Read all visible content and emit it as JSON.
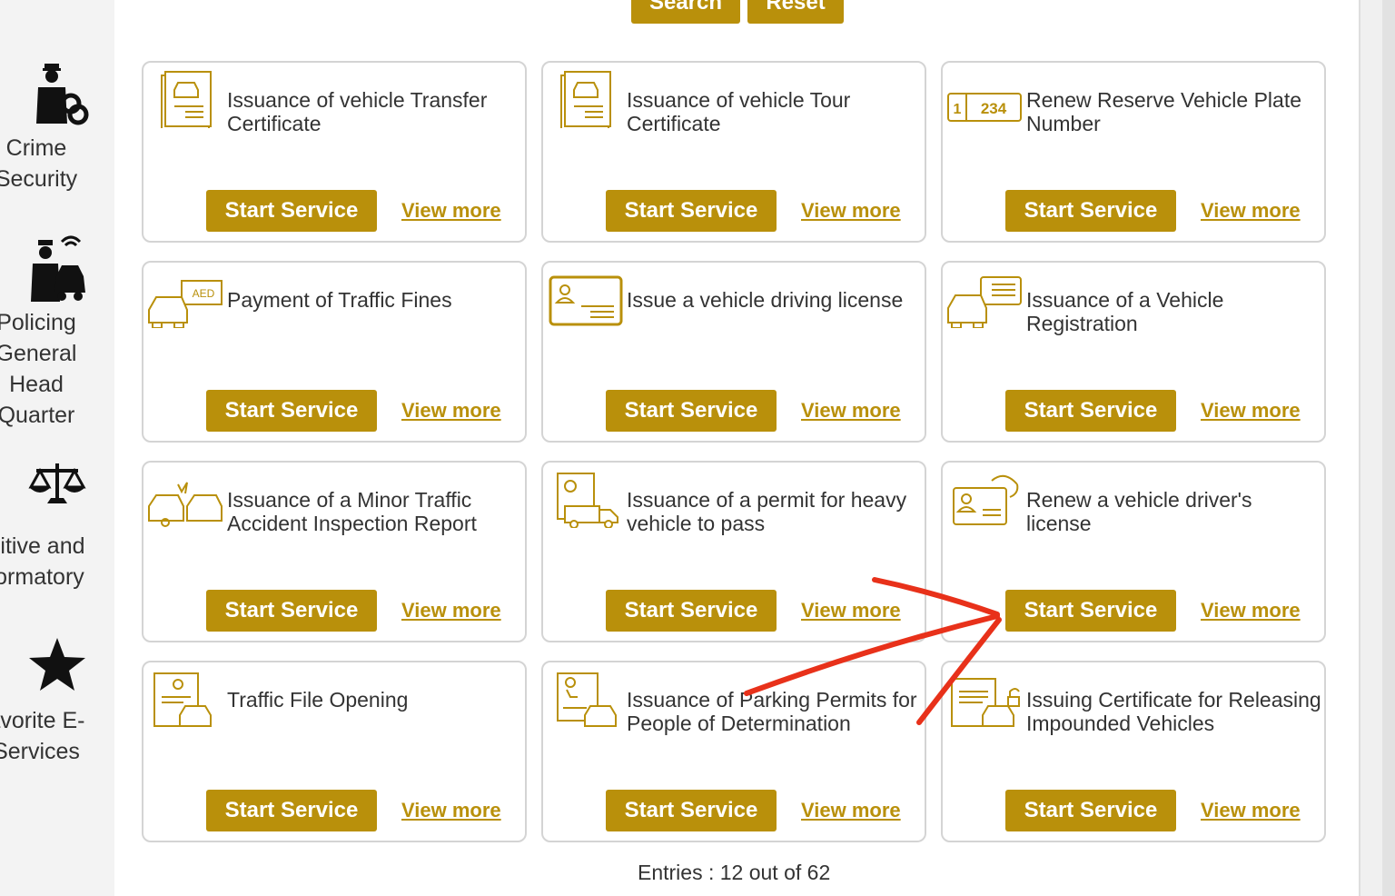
{
  "sidebar": {
    "items": [
      {
        "icon": "police-handcuffs-icon",
        "label": "Crime\nSecurity"
      },
      {
        "icon": "police-car-icon",
        "label": "Policing\nGeneral\nHead\nQuarter"
      },
      {
        "icon": "scales-icon",
        "label": "nitive and\nformatory"
      },
      {
        "icon": "star-icon",
        "label": "avorite E-\nServices"
      }
    ]
  },
  "search_bar": {
    "search_label": "Search",
    "reset_label": "Reset"
  },
  "cards": [
    {
      "title": "Issuance of vehicle Transfer Certificate",
      "icon": "document-car-icon",
      "start_label": "Start Service",
      "view_label": "View more"
    },
    {
      "title": "Issuance of vehicle Tour Certificate",
      "icon": "document-car-icon",
      "start_label": "Start Service",
      "view_label": "View more"
    },
    {
      "title": "Renew Reserve Vehicle Plate Number",
      "icon": "plate-number-icon",
      "plate_text_1": "1",
      "plate_text_2": "234",
      "start_label": "Start Service",
      "view_label": "View more"
    },
    {
      "title": "Payment of Traffic Fines",
      "icon": "car-fine-icon",
      "fine_text": "AED",
      "start_label": "Start Service",
      "view_label": "View more"
    },
    {
      "title": "Issue a vehicle driving license",
      "icon": "license-card-icon",
      "start_label": "Start Service",
      "view_label": "View more"
    },
    {
      "title": "Issuance of a Vehicle Registration",
      "icon": "car-registration-icon",
      "start_label": "Start Service",
      "view_label": "View more"
    },
    {
      "title": "Issuance of a Minor Traffic Accident Inspection Report",
      "icon": "car-accident-icon",
      "start_label": "Start Service",
      "view_label": "View more"
    },
    {
      "title": "Issuance of a permit for heavy vehicle to pass",
      "icon": "truck-permit-icon",
      "start_label": "Start Service",
      "view_label": "View more"
    },
    {
      "title": "Renew a vehicle driver's license",
      "icon": "license-renew-icon",
      "start_label": "Start Service",
      "view_label": "View more"
    },
    {
      "title": "Traffic File Opening",
      "icon": "traffic-file-icon",
      "start_label": "Start Service",
      "view_label": "View more"
    },
    {
      "title": "Issuance of Parking Permits for People of Determination",
      "icon": "accessible-parking-icon",
      "start_label": "Start Service",
      "view_label": "View more"
    },
    {
      "title": "Issuing Certificate for Releasing Impounded Vehicles",
      "icon": "impounded-release-icon",
      "start_label": "Start Service",
      "view_label": "View more"
    }
  ],
  "pagination": {
    "entries_text": "Entries : 12 out of 62"
  },
  "colors": {
    "accent": "#b9900b",
    "annotation": "#e8311a"
  }
}
